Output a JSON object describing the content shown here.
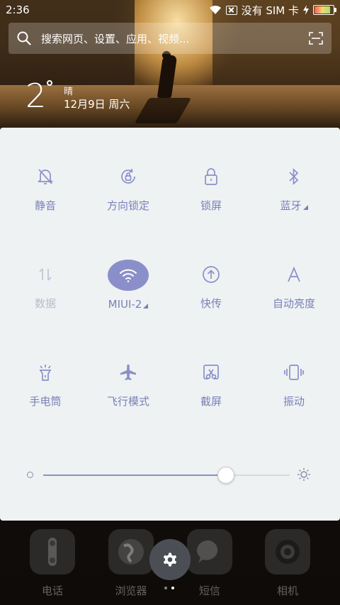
{
  "status_bar": {
    "time": "2:36",
    "carrier_text": "没有 SIM 卡",
    "battery_level": 0.85,
    "battery_color": "#ff5b5b"
  },
  "search": {
    "placeholder": "搜索网页、设置、应用、视频..."
  },
  "weather": {
    "temperature": "2",
    "condition": "晴",
    "date": "12月9日 周六"
  },
  "quick_settings": {
    "accent_color": "#8b8fc9",
    "tiles": [
      {
        "label": "静音",
        "icon": "bell-off-icon",
        "state": "off"
      },
      {
        "label": "方向锁定",
        "icon": "rotation-lock-icon",
        "state": "off"
      },
      {
        "label": "锁屏",
        "icon": "lock-icon",
        "state": "off"
      },
      {
        "label": "蓝牙",
        "icon": "bluetooth-icon",
        "state": "off",
        "has_menu": true
      },
      {
        "label": "数据",
        "icon": "data-arrows-icon",
        "state": "disabled"
      },
      {
        "label": "MIUI-2",
        "icon": "wifi-icon",
        "state": "on",
        "has_menu": true
      },
      {
        "label": "快传",
        "icon": "share-upload-icon",
        "state": "off"
      },
      {
        "label": "自动亮度",
        "icon": "auto-brightness-icon",
        "state": "off"
      },
      {
        "label": "手电筒",
        "icon": "flashlight-icon",
        "state": "off"
      },
      {
        "label": "飞行模式",
        "icon": "airplane-icon",
        "state": "off"
      },
      {
        "label": "截屏",
        "icon": "screenshot-icon",
        "state": "off"
      },
      {
        "label": "振动",
        "icon": "vibrate-icon",
        "state": "off"
      }
    ],
    "brightness": {
      "value": 0.74
    }
  },
  "dock": {
    "apps": [
      {
        "label": "电话",
        "icon": "phone-icon"
      },
      {
        "label": "浏览器",
        "icon": "globe-icon"
      },
      {
        "label": "短信",
        "icon": "message-icon"
      },
      {
        "label": "相机",
        "icon": "camera-icon"
      }
    ],
    "settings_button_icon": "gear-icon",
    "page_count": 2,
    "current_page": 2
  }
}
